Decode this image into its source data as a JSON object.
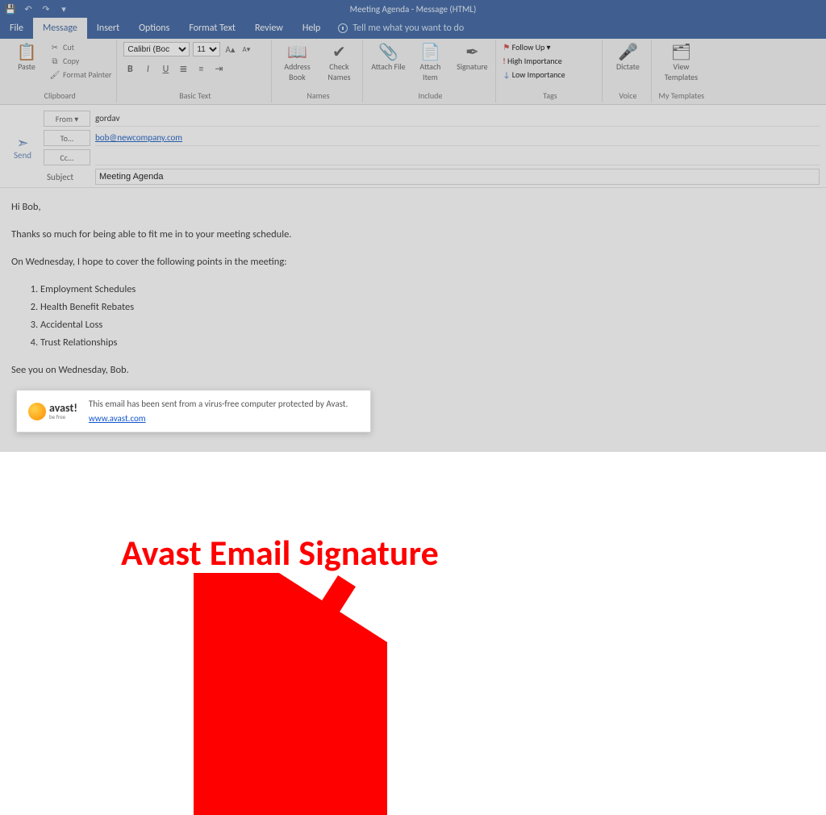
{
  "window": {
    "title": "Meeting Agenda  -  Message (HTML)"
  },
  "tabs": {
    "file": "File",
    "message": "Message",
    "insert": "Insert",
    "options": "Options",
    "format_text": "Format Text",
    "review": "Review",
    "help": "Help",
    "tell_me": "Tell me what you want to do"
  },
  "ribbon": {
    "clipboard": {
      "paste": "Paste",
      "cut": "Cut",
      "copy": "Copy",
      "format_painter": "Format Painter",
      "label": "Clipboard"
    },
    "font": {
      "family": "Calibri (Boc",
      "size": "11",
      "bold": "B",
      "italic": "I",
      "underline": "U",
      "label": "Basic Text"
    },
    "names": {
      "address_book": "Address Book",
      "check_names": "Check Names",
      "label": "Names"
    },
    "include": {
      "attach_file": "Attach File",
      "attach_item": "Attach Item",
      "signature": "Signature",
      "label": "Include"
    },
    "tags": {
      "follow_up": "Follow Up",
      "high": "High Importance",
      "low": "Low Importance",
      "label": "Tags"
    },
    "voice": {
      "dictate": "Dictate",
      "label": "Voice"
    },
    "templates": {
      "view": "View Templates",
      "label": "My Templates"
    }
  },
  "compose": {
    "send": "Send",
    "from_label": "From ▾",
    "from_value": "gordav",
    "to_label": "To...",
    "to_value": "bob@newcompany.com",
    "cc_label": "Cc...",
    "cc_value": "",
    "subject_label": "Subject",
    "subject_value": "Meeting Agenda"
  },
  "body": {
    "greeting": "Hi Bob,",
    "p1": "Thanks so much for being able to fit me in to your meeting schedule.",
    "p2": "On Wednesday, I hope to cover the following points in the meeting:",
    "list": [
      "Employment Schedules",
      "Health Benefit Rebates",
      "Accidental Loss",
      "Trust Relationships"
    ],
    "closing": "See you on Wednesday, Bob."
  },
  "avast": {
    "brand": "avast!",
    "tagline": "be free",
    "text": "This email has been sent from a virus-free computer protected by Avast.",
    "link": "www.avast.com"
  },
  "annotation": {
    "label": "Avast Email Signature"
  }
}
